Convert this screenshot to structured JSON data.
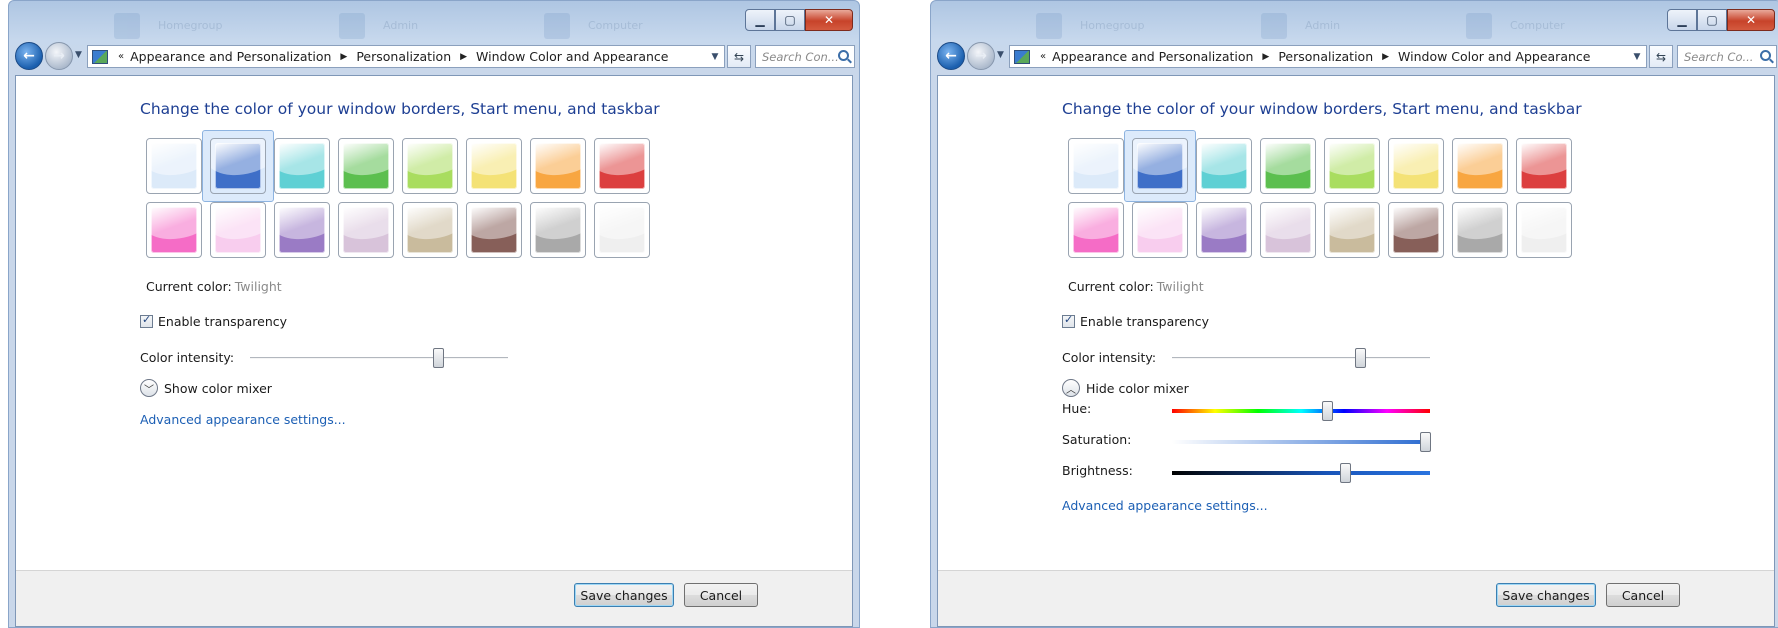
{
  "windows": [
    {
      "id": "left",
      "desktop_ghosts": [
        "Homegroup",
        "Admin",
        "Computer"
      ],
      "nav": {
        "chevron": "«",
        "breadcrumbs": [
          "Appearance and Personalization",
          "Personalization",
          "Window Color and Appearance"
        ],
        "search_placeholder": "Search Con..."
      },
      "heading": "Change the color of your window borders, Start menu, and taskbar",
      "current_color_label": "Current color:",
      "current_color_value": "Twilight",
      "transparency_label": "Enable transparency",
      "transparency_checked": true,
      "intensity_label": "Color intensity:",
      "intensity_value": 0.73,
      "mixer_label": "Show color mixer",
      "mixer_expanded": false,
      "advanced_link": "Advanced appearance settings...",
      "save_label": "Save changes",
      "cancel_label": "Cancel"
    },
    {
      "id": "right",
      "desktop_ghosts": [
        "Homegroup",
        "Admin",
        "Computer"
      ],
      "nav": {
        "chevron": "«",
        "breadcrumbs": [
          "Appearance and Personalization",
          "Personalization",
          "Window Color and Appearance"
        ],
        "search_placeholder": "Search Co..."
      },
      "heading": "Change the color of your window borders, Start menu, and taskbar",
      "current_color_label": "Current color:",
      "current_color_value": "Twilight",
      "transparency_label": "Enable transparency",
      "transparency_checked": true,
      "intensity_label": "Color intensity:",
      "intensity_value": 0.73,
      "mixer_label": "Hide color mixer",
      "mixer_expanded": true,
      "hue_label": "Hue:",
      "hue_value": 0.6,
      "saturation_label": "Saturation:",
      "saturation_value": 0.98,
      "brightness_label": "Brightness:",
      "brightness_value": 0.67,
      "advanced_link": "Advanced appearance settings...",
      "save_label": "Save changes",
      "cancel_label": "Cancel"
    }
  ],
  "swatch_colors": [
    "#dceaf9",
    "#3f6fc8",
    "#5fd0d4",
    "#5cbf4f",
    "#a9dd5f",
    "#f4e276",
    "#f8a641",
    "#dc3f3f",
    "#f56cc6",
    "#f8cdee",
    "#9a7bc5",
    "#d8c3da",
    "#c9bb9d",
    "#875f59",
    "#a9a9a9",
    "#efefef"
  ],
  "selected_swatch": 1,
  "icons": [
    "back-arrow-icon",
    "forward-arrow-icon",
    "control-panel-icon",
    "refresh-icon",
    "search-icon",
    "minimize-icon",
    "maximize-icon",
    "close-icon",
    "checkmark-icon",
    "chevron-down-icon",
    "chevron-up-icon"
  ]
}
